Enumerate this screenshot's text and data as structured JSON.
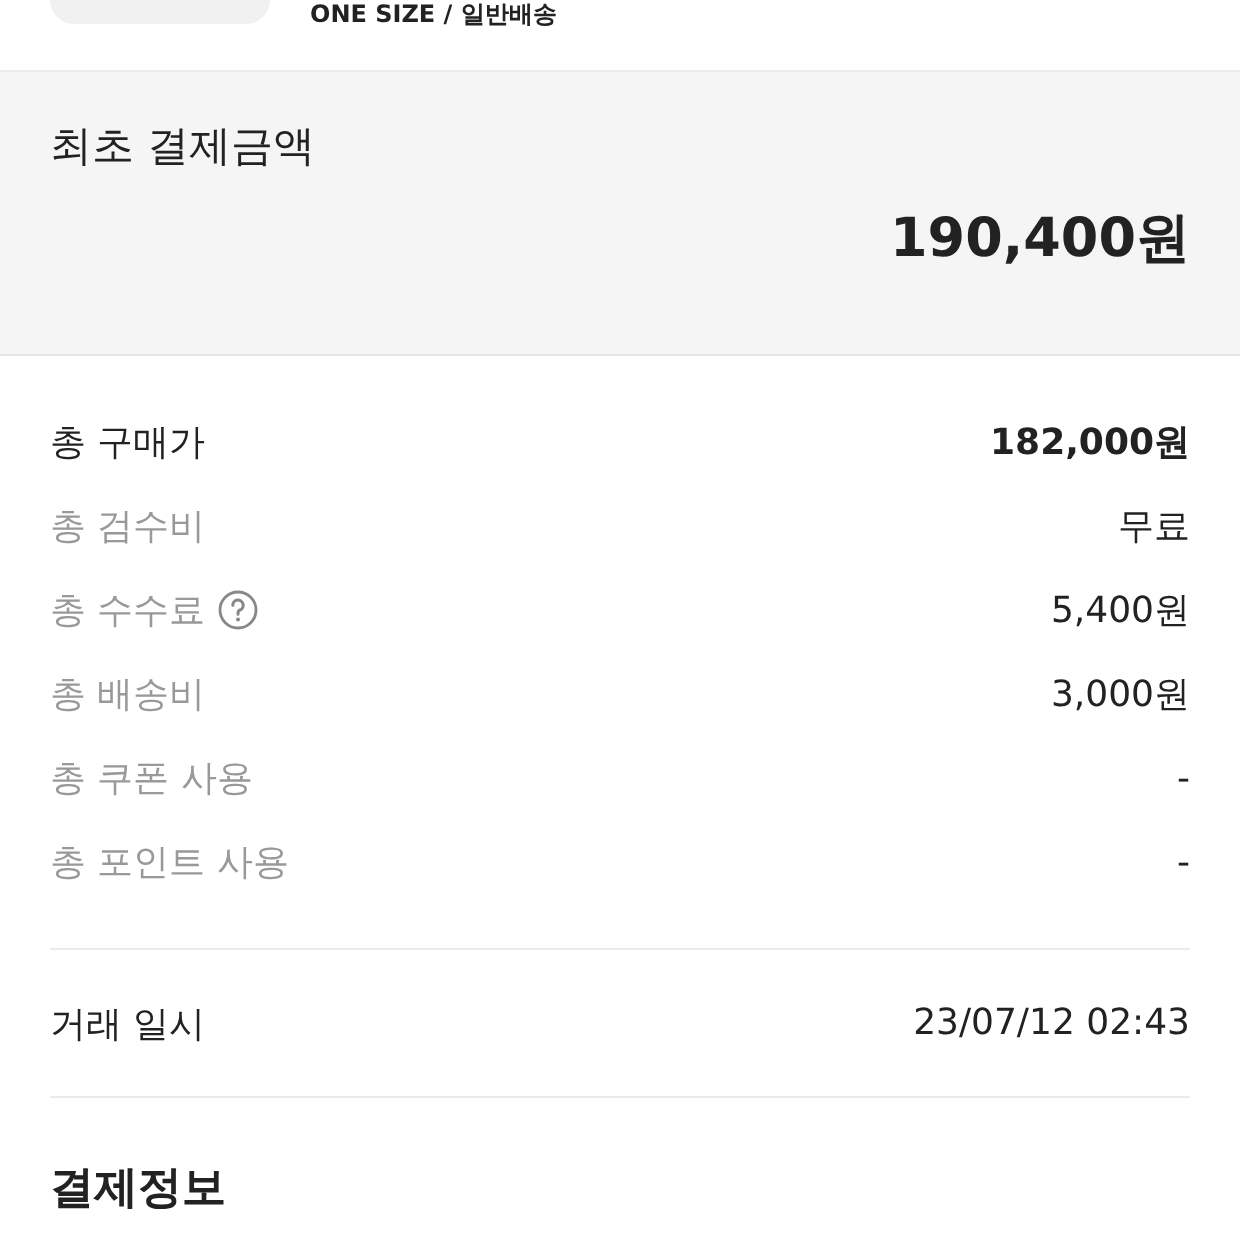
{
  "product": {
    "option": "ONE SIZE / 일반배송"
  },
  "summary": {
    "title": "최초 결제금액",
    "amount": "190,400원"
  },
  "rows": [
    {
      "kind": "main",
      "label": "총 구매가",
      "value": "182,000원",
      "has_help": false
    },
    {
      "kind": "sub",
      "label": "총 검수비",
      "value": "무료",
      "has_help": false
    },
    {
      "kind": "sub",
      "label": "총 수수료",
      "value": "5,400원",
      "has_help": true
    },
    {
      "kind": "sub",
      "label": "총 배송비",
      "value": "3,000원",
      "has_help": false
    },
    {
      "kind": "sub",
      "label": "총 쿠폰 사용",
      "value": "-",
      "has_help": false
    },
    {
      "kind": "sub",
      "label": "총 포인트 사용",
      "value": "-",
      "has_help": false
    }
  ],
  "trade": {
    "label": "거래 일시",
    "value": "23/07/12 02:43"
  },
  "section_title": "결제정보"
}
